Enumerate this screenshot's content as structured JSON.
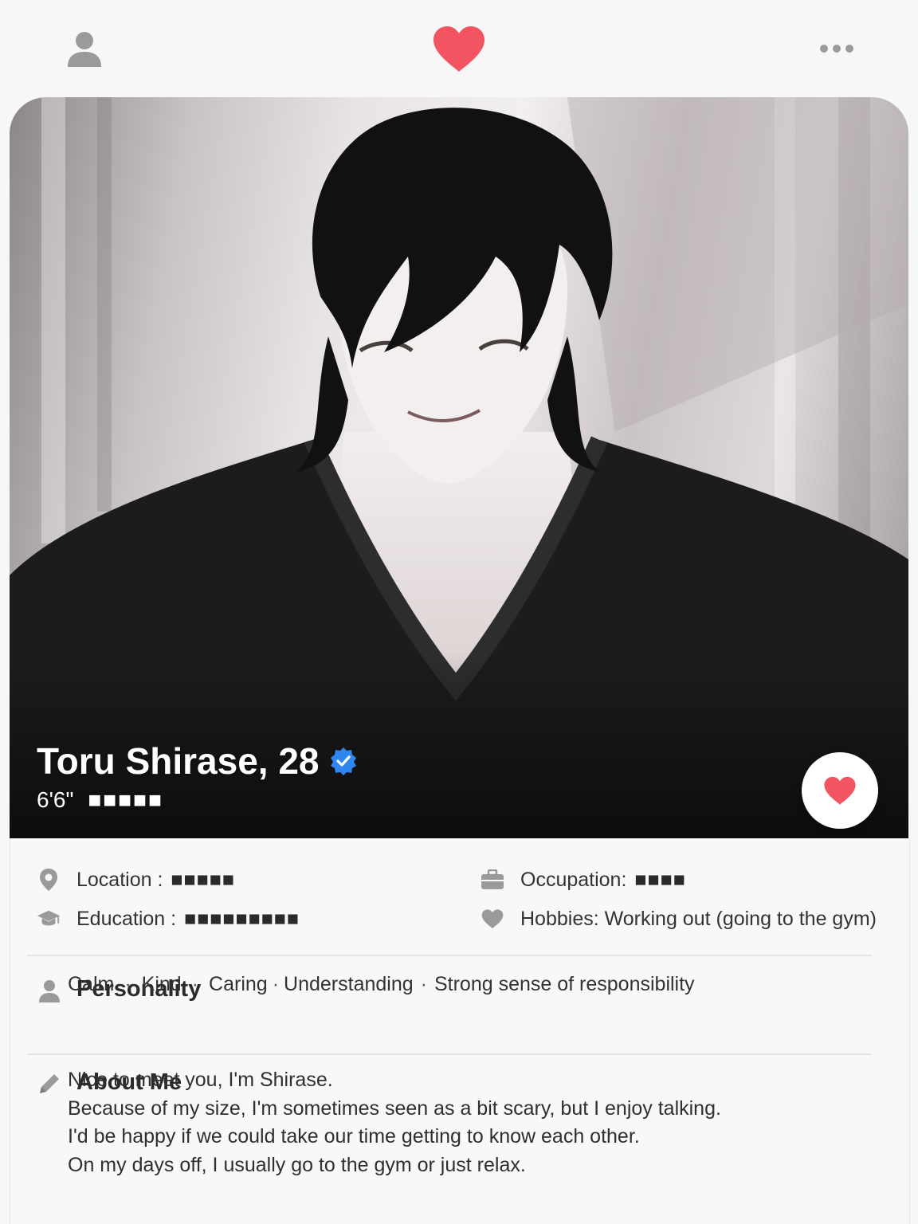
{
  "header": {
    "profile_icon": "person-icon",
    "like_icon": "heart-icon",
    "more_icon": "more-dots-icon"
  },
  "profile": {
    "name_age": "Toru Shirase, 28",
    "verified_icon": "verified-badge-icon",
    "height": "6'6\"",
    "height_redacted": "■■■■■",
    "like_button_icon": "heart-icon"
  },
  "details": {
    "location_label": "Location :",
    "location_value": "■■■■■",
    "occupation_label": "Occupation:",
    "occupation_value": "■■■■",
    "education_label": "Education :",
    "education_value": "■■■■■■■■■",
    "hobbies_text": "Hobbies: Working out (going to the gym)"
  },
  "personality": {
    "title": "Personality",
    "traits": [
      "Calm",
      "Kind",
      "Caring",
      "Understanding",
      "Strong sense of responsibility"
    ],
    "separator": "·"
  },
  "about": {
    "title": "About Me",
    "lines": [
      "Nice to meet you, I'm Shirase.",
      "Because of my size, I'm sometimes seen as a bit scary, but I enjoy talking.",
      "I'd be happy if we could take our time getting to know each other.",
      "On my days off, I usually go to the gym or just relax."
    ]
  },
  "colors": {
    "heart": "#f25461",
    "verified": "#2f86f0",
    "icon_gray": "#9a9a9a"
  }
}
